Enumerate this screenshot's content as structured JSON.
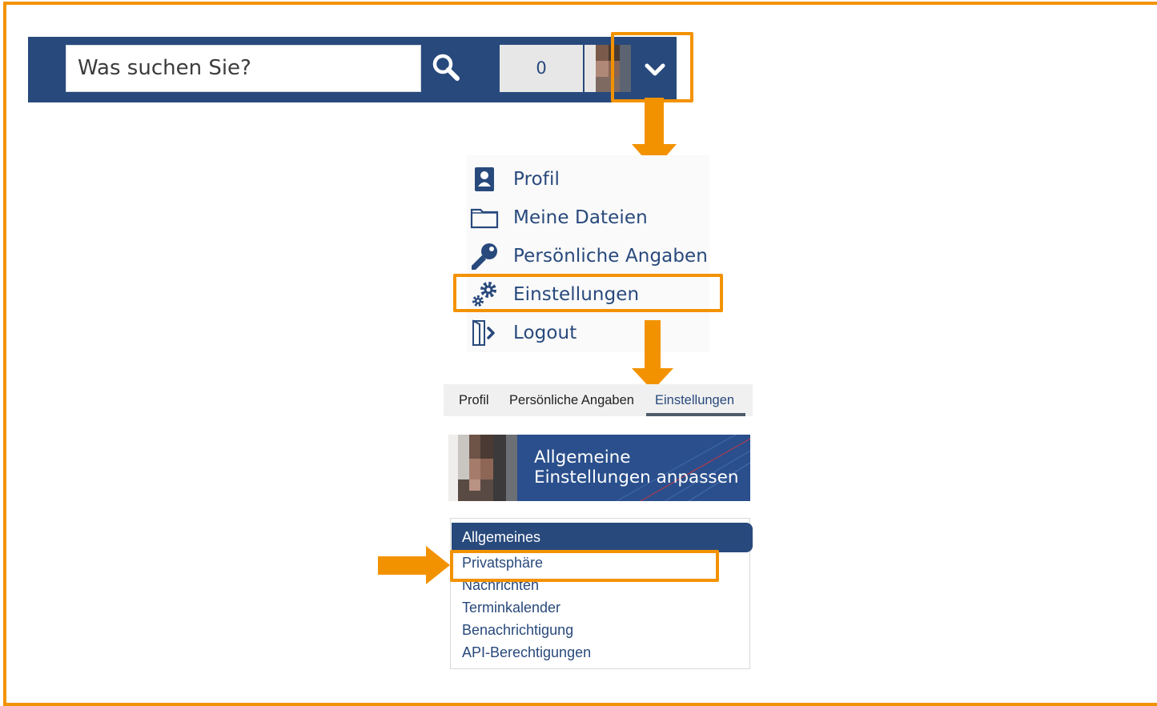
{
  "header": {
    "search_placeholder": "Was suchen Sie?",
    "search_icon": "search-icon",
    "counter_value": "0",
    "avatar_icon": "user-avatar",
    "dropdown_icon": "chevron-down-icon"
  },
  "dropdown_menu": {
    "items": [
      {
        "label": "Profil",
        "icon": "user-icon"
      },
      {
        "label": "Meine Dateien",
        "icon": "folder-icon"
      },
      {
        "label": "Persönliche Angaben",
        "icon": "key-icon"
      },
      {
        "label": "Einstellungen",
        "icon": "gears-icon"
      },
      {
        "label": "Logout",
        "icon": "logout-icon"
      }
    ]
  },
  "tabs": {
    "items": [
      "Profil",
      "Persönliche Angaben",
      "Einstellungen"
    ],
    "active": "Einstellungen"
  },
  "banner": {
    "line1": "Allgemeine",
    "line2": "Einstellungen anpassen"
  },
  "settings_nav": {
    "header": "Allgemeines",
    "links": [
      "Privatsphäre",
      "Nachrichten",
      "Terminkalender",
      "Benachrichtigung",
      "API-Berechtigungen"
    ]
  },
  "colors": {
    "brand_blue": "#28497c",
    "highlight_orange": "#f39200"
  }
}
